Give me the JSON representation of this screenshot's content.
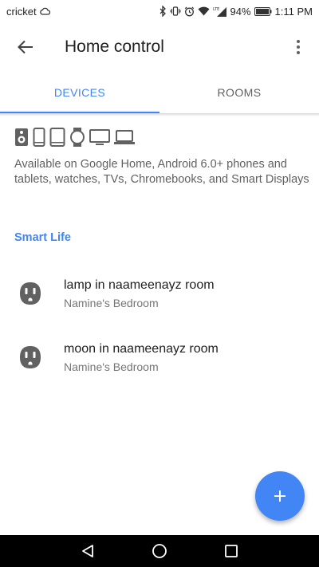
{
  "status_bar": {
    "carrier": "cricket",
    "battery": "94%",
    "time": "1:11 PM",
    "network_label": "LTE"
  },
  "app_bar": {
    "title": "Home control"
  },
  "tabs": [
    {
      "label": "DEVICES",
      "active": true
    },
    {
      "label": "ROOMS",
      "active": false
    }
  ],
  "device_types": [
    "speaker-icon",
    "phone-icon",
    "tablet-icon",
    "watch-icon",
    "tv-icon",
    "laptop-icon"
  ],
  "availability_text": "Available on Google Home, Android 6.0+ phones and tablets, watches, TVs, Chromebooks, and Smart Displays",
  "section": {
    "title": "Smart Life"
  },
  "devices": [
    {
      "name": "lamp in naameenayz room",
      "room": "Namine's Bedroom",
      "icon": "outlet-icon"
    },
    {
      "name": "moon in naameenayz room",
      "room": "Namine's Bedroom",
      "icon": "outlet-icon"
    }
  ],
  "colors": {
    "accent": "#4285f4",
    "text_primary": "#212121",
    "text_secondary": "#757575"
  }
}
